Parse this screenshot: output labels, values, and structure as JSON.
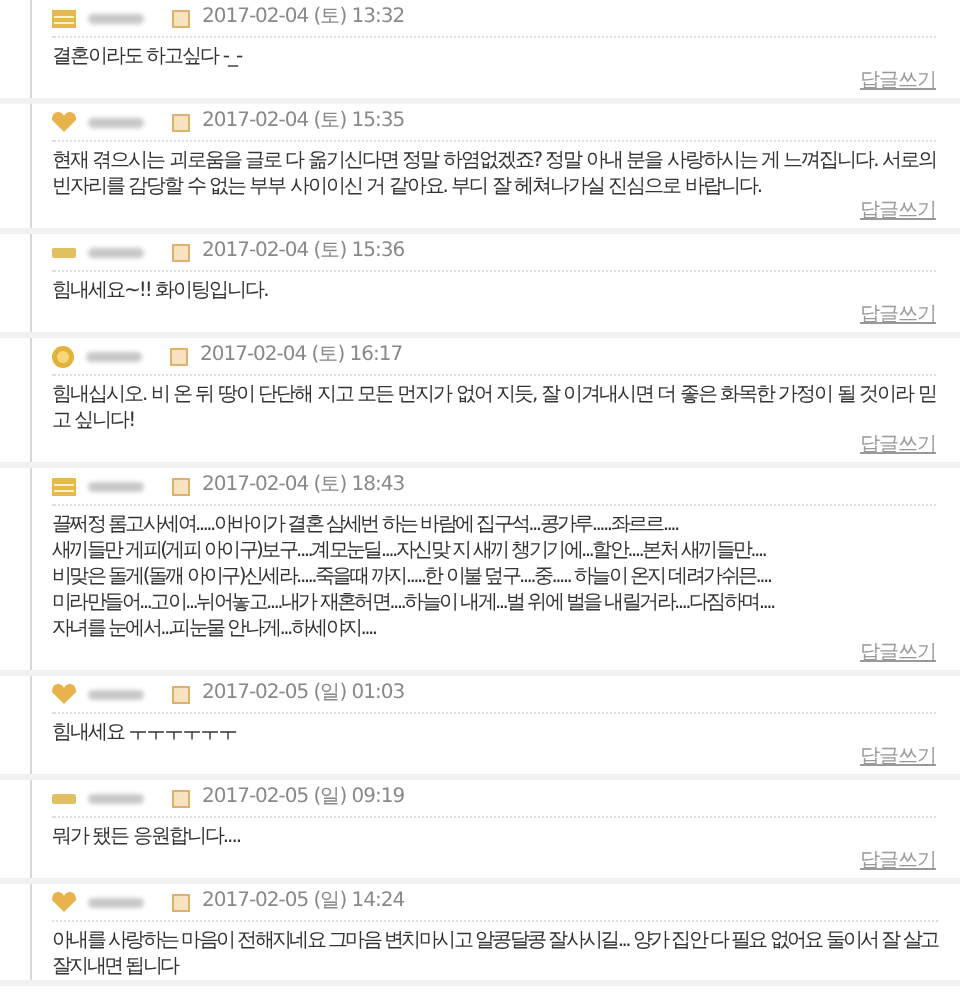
{
  "comments": [
    {
      "kind": "stack",
      "date": "2017-02-04 (토) 13:32",
      "text": "결혼이라도 하고싶다 -_-",
      "reply": "답글쓰기"
    },
    {
      "kind": "heart",
      "date": "2017-02-04 (토) 15:35",
      "text": "현재 겪으시는 괴로움을 글로 다 옮기신다면 정말 하염없겠죠? 정말 아내 분을 사랑하시는 게 느껴집니다. 서로의 빈자리를 감당할 수 없는 부부 사이이신 거 같아요. 부디 잘 헤쳐나가실 진심으로 바랍니다.",
      "reply": "답글쓰기"
    },
    {
      "kind": "bar",
      "date": "2017-02-04 (토) 15:36",
      "text": "힘내세요~!! 화이팅입니다.",
      "reply": "답글쓰기"
    },
    {
      "kind": "coin",
      "date": "2017-02-04 (토) 16:17",
      "text": "힘내십시오. 비 온 뒤 땅이 단단해 지고 모든 먼지가 없어 지듯, 잘 이겨내시면 더 좋은 화목한 가정이 될 것이라 믿고 싶니다!",
      "reply": "답글쓰기"
    },
    {
      "kind": "stack",
      "date": "2017-02-04 (토) 18:43",
      "lines": [
        "끌쩌정 롬고사세여.....아바이가 결혼 삼세번 하는  바람에 집구석...콩가루.....좌르르....",
        "새끼들만 게피(게피 아이구)보구....계모눈딜....자신맞 지 새끼 챙기기에...할안....본처 새끼들만....",
        "비맞은 돌게(돌깨 아이구)신세라.....죽을때 까지.....한 이불 덮구....중..... 하늘이 온지 데려가쉬믄....",
        "미라만들어...고이...뉘어놓고....내가 재혼허면....하늘이 내게...벌 위에 벌을 내릴거라....다짐하며....",
        "자녀를 눈에서...피눈물 안나게...하세야지...."
      ],
      "reply": "답글쓰기"
    },
    {
      "kind": "heart",
      "date": "2017-02-05 (일) 01:03",
      "text": "힘내세요 ㅜㅜㅜㅜㅜㅜ",
      "reply": "답글쓰기"
    },
    {
      "kind": "bar",
      "date": "2017-02-05 (일) 09:19",
      "text": "뭐가 됐든 응원합니다....",
      "reply": "답글쓰기"
    },
    {
      "kind": "heart",
      "date": "2017-02-05 (일) 14:24",
      "lines": [
        "아내를 사랑하는 마음이 전해지네요 그마음 변치마시고 알콩달콩 잘사시길... 양가 집안 다 필요 없어요 둘이서 잘 살고",
        "잘지내면 됩니다"
      ]
    }
  ]
}
